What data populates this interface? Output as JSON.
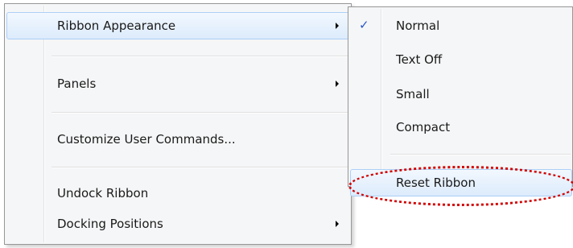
{
  "main_menu": {
    "items": [
      {
        "label": "Ribbon Appearance",
        "has_submenu": true
      },
      {
        "label": "Panels",
        "has_submenu": true
      },
      {
        "label": "Customize User Commands..."
      },
      {
        "label": "Undock Ribbon"
      },
      {
        "label": "Docking Positions",
        "has_submenu": true
      }
    ]
  },
  "submenu": {
    "items": [
      {
        "label": "Normal",
        "checked": true
      },
      {
        "label": "Text Off"
      },
      {
        "label": "Small"
      },
      {
        "label": "Compact"
      },
      {
        "label": "Reset Ribbon"
      }
    ]
  },
  "colors": {
    "highlight_ring": "#d10000",
    "hover_border": "#aecff7",
    "check_mark": "#2a57c8"
  }
}
